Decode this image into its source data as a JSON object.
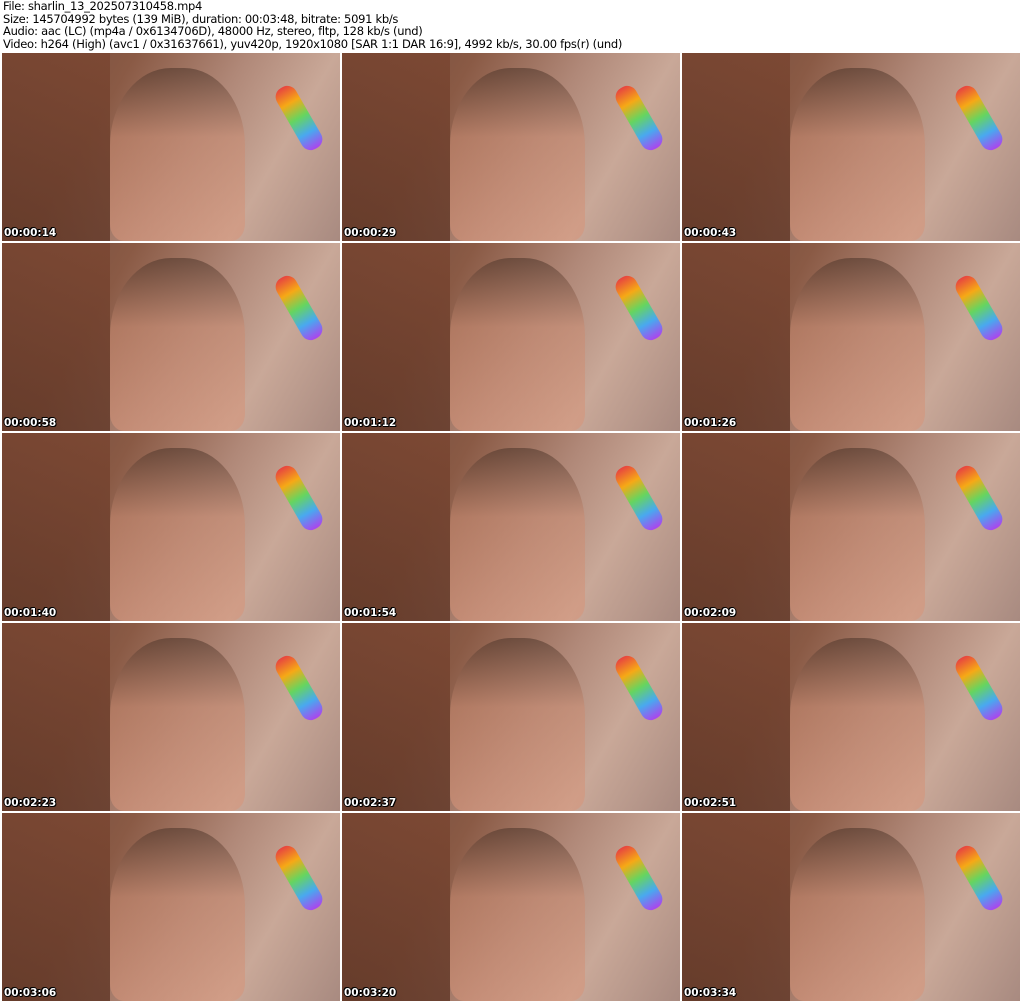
{
  "header": {
    "file": "File: sharlin_13_202507310458.mp4",
    "size": "Size: 145704992 bytes (139 MiB), duration: 00:03:48, bitrate: 5091 kb/s",
    "audio": "Audio: aac (LC) (mp4a / 0x6134706D), 48000 Hz, stereo, fltp, 128 kb/s (und)",
    "video": "Video: h264 (High) (avc1 / 0x31637661), yuv420p, 1920x1080 [SAR 1:1 DAR 16:9], 4992 kb/s, 30.00 fps(r) (und)"
  },
  "thumbnails": [
    {
      "timestamp": "00:00:14"
    },
    {
      "timestamp": "00:00:29"
    },
    {
      "timestamp": "00:00:43"
    },
    {
      "timestamp": "00:00:58"
    },
    {
      "timestamp": "00:01:12"
    },
    {
      "timestamp": "00:01:26"
    },
    {
      "timestamp": "00:01:40"
    },
    {
      "timestamp": "00:01:54"
    },
    {
      "timestamp": "00:02:09"
    },
    {
      "timestamp": "00:02:23"
    },
    {
      "timestamp": "00:02:37"
    },
    {
      "timestamp": "00:02:51"
    },
    {
      "timestamp": "00:03:06"
    },
    {
      "timestamp": "00:03:20"
    },
    {
      "timestamp": "00:03:34"
    }
  ]
}
